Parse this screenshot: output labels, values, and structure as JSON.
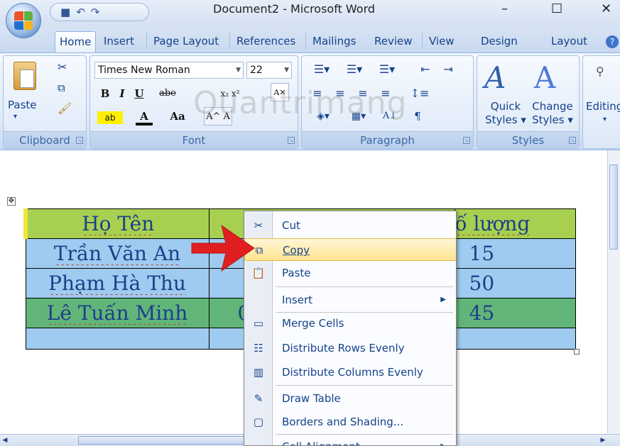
{
  "window": {
    "title": "Document2 - Microsoft Word",
    "minimize": "–",
    "maximize": "☐",
    "close": "✕"
  },
  "tabs": [
    "Home",
    "Insert",
    "Page Layout",
    "References",
    "Mailings",
    "Review",
    "View",
    "Design",
    "Layout"
  ],
  "ribbon": {
    "clipboard": {
      "label": "Clipboard",
      "paste": "Paste"
    },
    "font": {
      "label": "Font",
      "name": "Times New Roman",
      "size": "22",
      "bold": "B",
      "italic": "I",
      "underline": "U",
      "strike": "abe",
      "grow": "A",
      "aa": "Aa"
    },
    "paragraph": {
      "label": "Paragraph"
    },
    "styles": {
      "label": "Styles",
      "quick": "Quick",
      "quick2": "Styles",
      "change": "Change",
      "change2": "Styles"
    },
    "editing": {
      "label": "Editing"
    }
  },
  "watermark": "Quantrimang",
  "table": {
    "rows": [
      [
        "Họ Tên",
        "",
        "ố lượng"
      ],
      [
        "Trần Văn An",
        "",
        "15"
      ],
      [
        "Phạm Hà Thu",
        "",
        "50"
      ],
      [
        "Lê Tuấn Minh",
        "0",
        "45"
      ],
      [
        "",
        "",
        ""
      ]
    ],
    "colors": {
      "header": "#a8d050",
      "blue": "#9ecbef",
      "green": "#62b579",
      "edge": "#f2e43a"
    }
  },
  "context_menu": {
    "cut": "Cut",
    "copy": "Copy",
    "paste": "Paste",
    "insert": "Insert",
    "merge": "Merge Cells",
    "dist_rows": "Distribute Rows Evenly",
    "dist_cols": "Distribute Columns Evenly",
    "draw": "Draw Table",
    "borders": "Borders and Shading...",
    "align": "Cell Alignment"
  }
}
